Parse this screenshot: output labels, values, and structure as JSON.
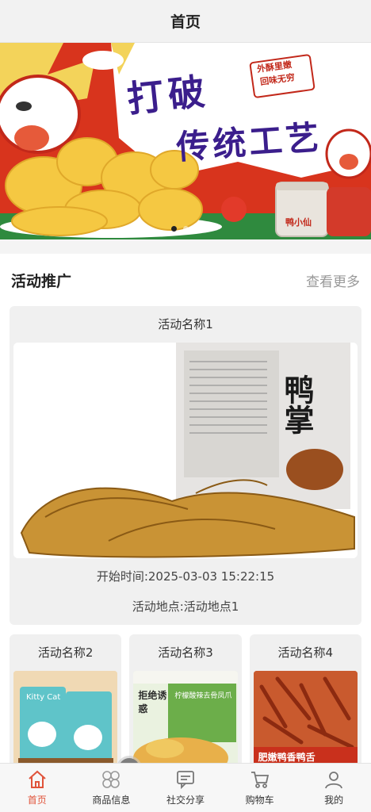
{
  "header": {
    "title": "首页"
  },
  "banner": {
    "headline_line1": "打破",
    "headline_line2": "传统工艺",
    "badge_line1": "外酥里嫩",
    "badge_line2": "回味无穷",
    "jar_label": "鸭小仙",
    "slide_count": 3,
    "active_slide": 1
  },
  "promo": {
    "title": "活动推广",
    "more_label": "查看更多",
    "featured": {
      "name": "活动名称1",
      "package_text": "鸭掌",
      "start_time": "开始时间:2025-03-03 15:22:15",
      "location": "活动地点:活动地点1"
    },
    "items": [
      {
        "name": "活动名称2",
        "package_text": "Kitty Cat"
      },
      {
        "name": "活动名称3",
        "package_text": "拒绝诱惑",
        "package_sub": "柠檬酸辣去骨凤爪"
      },
      {
        "name": "活动名称4",
        "package_text": "肥嫩鸭香鸭舌"
      }
    ]
  },
  "tabbar": {
    "items": [
      {
        "label": "首页",
        "icon": "home-icon",
        "active": true
      },
      {
        "label": "商品信息",
        "icon": "grid-icon",
        "active": false
      },
      {
        "label": "社交分享",
        "icon": "chat-icon",
        "active": false
      },
      {
        "label": "购物车",
        "icon": "cart-icon",
        "active": false
      },
      {
        "label": "我的",
        "icon": "user-icon",
        "active": false
      }
    ]
  },
  "colors": {
    "accent": "#e0533a",
    "banner_red": "#d8341d",
    "banner_purple": "#3b1e8c",
    "text_muted": "#999999"
  }
}
